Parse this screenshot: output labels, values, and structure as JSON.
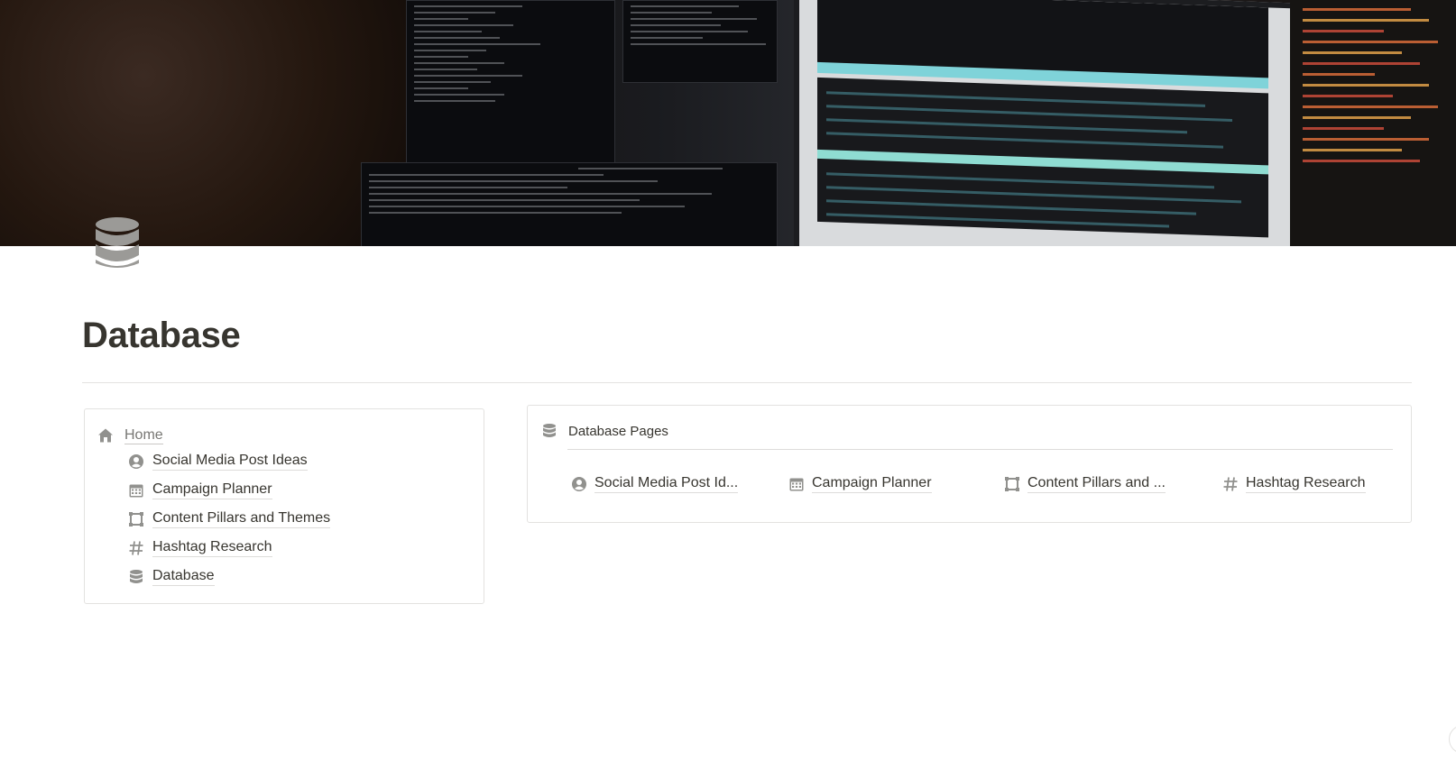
{
  "page": {
    "title": "Database",
    "icon": "database-icon",
    "cover": "terminal-screens-photo"
  },
  "nav": {
    "home_label": "Home",
    "home_icon": "home-icon",
    "items": [
      {
        "label": "Social Media Post Ideas",
        "icon": "person-circle-icon"
      },
      {
        "label": "Campaign Planner",
        "icon": "calendar-icon"
      },
      {
        "label": "Content Pillars and Themes",
        "icon": "frame-icon"
      },
      {
        "label": "Hashtag Research",
        "icon": "hashtag-icon"
      },
      {
        "label": "Database",
        "icon": "database-icon"
      }
    ]
  },
  "database_pages": {
    "title": "Database Pages",
    "icon": "database-icon",
    "links": [
      {
        "label": "Social Media Post Id...",
        "icon": "person-circle-icon"
      },
      {
        "label": "Campaign Planner",
        "icon": "calendar-icon"
      },
      {
        "label": "Content Pillars and ...",
        "icon": "frame-icon"
      },
      {
        "label": "Hashtag Research",
        "icon": "hashtag-icon"
      }
    ]
  },
  "colors": {
    "text": "#37352f",
    "muted_icon": "#91918e",
    "border": "#e3e2e0"
  }
}
